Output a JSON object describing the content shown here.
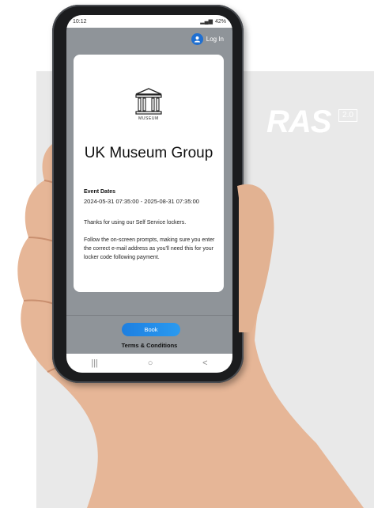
{
  "brand": {
    "logo_text": "RAS",
    "version": "2.0"
  },
  "status_bar": {
    "time": "10:12",
    "battery": "42%"
  },
  "header": {
    "login_label": "Log In"
  },
  "card": {
    "icon_label": "MUSEUM",
    "title": "UK Museum Group",
    "event_dates_label": "Event Dates",
    "event_dates_value": "2024-05-31 07:35:00 - 2025-08-31 07:35:00",
    "thanks_text": "Thanks for using our Self Service lockers.",
    "instructions_text": "Follow the on-screen prompts, making sure you enter the correct e-mail address as you'll need this for your locker code following payment."
  },
  "footer": {
    "book_label": "Book",
    "terms_label": "Terms & Conditions"
  },
  "nav": {
    "recent": "|||",
    "home": "○",
    "back": "<"
  },
  "colors": {
    "accent": "#1f6fd1",
    "screen_bg": "#8f9499",
    "panel_bg": "#e9e9e9"
  }
}
